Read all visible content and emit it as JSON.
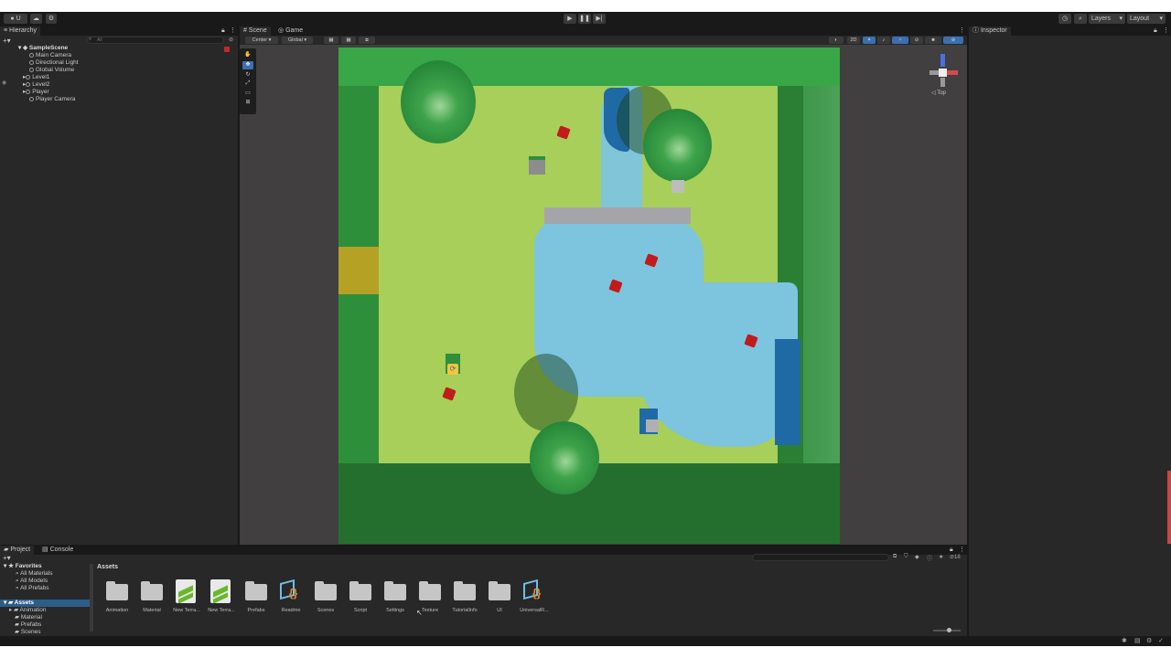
{
  "toolbar": {
    "account_label": "U",
    "layers_label": "Layers",
    "layout_label": "Layout",
    "play_icon": "play-icon",
    "pause_icon": "pause-icon",
    "step_icon": "step-icon"
  },
  "hierarchy": {
    "tab_label": "Hierarchy",
    "search_placeholder": "All",
    "scene_name": "SampleScene",
    "items": [
      {
        "label": "Main Camera"
      },
      {
        "label": "Directional Light"
      },
      {
        "label": "Global Volume"
      },
      {
        "label": "Level1"
      },
      {
        "label": "Level2"
      },
      {
        "label": "Player"
      },
      {
        "label": "Player Camera"
      }
    ]
  },
  "scene_view": {
    "tabs": [
      {
        "label": "Scene"
      },
      {
        "label": "Game"
      }
    ],
    "pivot_label": "Center",
    "space_label": "Global",
    "mode_2d": "2D",
    "gizmo_label": "Top"
  },
  "inspector": {
    "tab_label": "Inspector"
  },
  "project": {
    "tabs": [
      {
        "label": "Project"
      },
      {
        "label": "Console"
      }
    ],
    "favorites_label": "Favorites",
    "favorites": [
      {
        "label": "All Materials"
      },
      {
        "label": "All Models"
      },
      {
        "label": "All Prefabs"
      }
    ],
    "assets_root": "Assets",
    "tree_folders": [
      {
        "label": "Animation"
      },
      {
        "label": "Material"
      },
      {
        "label": "Prefabs"
      },
      {
        "label": "Scenes"
      }
    ],
    "breadcrumb": "Assets",
    "hidden_count": "18",
    "assets": [
      {
        "label": "Animation",
        "icon": "folder-icon"
      },
      {
        "label": "Material",
        "icon": "folder-icon"
      },
      {
        "label": "New Terra...",
        "icon": "terrain-icon"
      },
      {
        "label": "New Terra...",
        "icon": "terrain-icon"
      },
      {
        "label": "Prefabs",
        "icon": "folder-icon"
      },
      {
        "label": "Readme",
        "icon": "script-asset-icon"
      },
      {
        "label": "Scenes",
        "icon": "folder-icon"
      },
      {
        "label": "Script",
        "icon": "folder-icon"
      },
      {
        "label": "Settings",
        "icon": "folder-icon"
      },
      {
        "label": "Texture",
        "icon": "folder-icon"
      },
      {
        "label": "TutorialInfo",
        "icon": "folder-icon"
      },
      {
        "label": "UI",
        "icon": "folder-icon"
      },
      {
        "label": "UniversalR...",
        "icon": "script-asset-icon"
      }
    ]
  },
  "colors": {
    "editor_bg": "#191919",
    "panel_bg": "#282828",
    "scene_bg": "#413f3f",
    "grass": "#a7cf5a",
    "water": "#7dc4df",
    "wall": "#2f8f3c"
  }
}
